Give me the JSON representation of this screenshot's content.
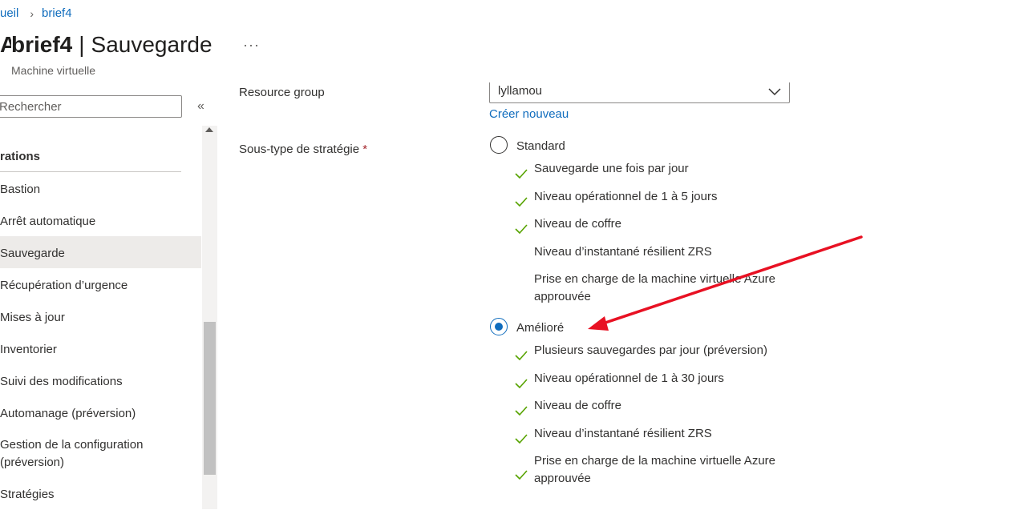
{
  "breadcrumb": {
    "home": "ueil",
    "current": "brief4"
  },
  "header": {
    "accent": "A",
    "resource_name": "brief4",
    "separator": "|",
    "page": "Sauvegarde",
    "more": "···",
    "subtitle": "Machine virtuelle"
  },
  "sidebar": {
    "search_value": "Rechercher",
    "collapse": "«",
    "section": "rations",
    "items": [
      {
        "label": "Bastion"
      },
      {
        "label": "Arrêt automatique"
      },
      {
        "label": "Sauvegarde",
        "selected": true
      },
      {
        "label": "Récupération d’urgence"
      },
      {
        "label": "Mises à jour"
      },
      {
        "label": "Inventorier"
      },
      {
        "label": "Suivi des modifications"
      },
      {
        "label": "Automanage (préversion)"
      },
      {
        "label": "Gestion de la configuration",
        "line2": "(préversion)"
      },
      {
        "label": "Stratégies"
      }
    ]
  },
  "form": {
    "resource_group_label": "Resource group",
    "resource_group_value": "lyllamou",
    "create_new": "Créer nouveau",
    "subtype_label": "Sous-type de stratégie",
    "required_mark": "*",
    "options": [
      {
        "label": "Standard",
        "checked": false,
        "features": [
          {
            "text": "Sauvegarde une fois par jour",
            "check": true
          },
          {
            "text": "Niveau opérationnel de 1 à 5 jours",
            "check": true
          },
          {
            "text": "Niveau de coffre",
            "check": true
          },
          {
            "text": "Niveau d’instantané résilient ZRS",
            "check": false
          },
          {
            "text": "Prise en charge de la machine virtuelle Azure",
            "line2": "approuvée",
            "check": false
          }
        ]
      },
      {
        "label": "Amélioré",
        "checked": true,
        "features": [
          {
            "text": "Plusieurs sauvegardes par jour (préversion)",
            "check": true
          },
          {
            "text": "Niveau opérationnel de 1 à 30 jours",
            "check": true
          },
          {
            "text": "Niveau de coffre",
            "check": true
          },
          {
            "text": "Niveau d’instantané résilient ZRS",
            "check": true
          },
          {
            "text": "Prise en charge de la machine virtuelle Azure",
            "line2": "approuvée",
            "check": true
          }
        ]
      }
    ]
  },
  "colors": {
    "link": "#0f6cbd",
    "check": "#57a300",
    "annotation_arrow": "#e81123",
    "required": "#a4262c"
  }
}
